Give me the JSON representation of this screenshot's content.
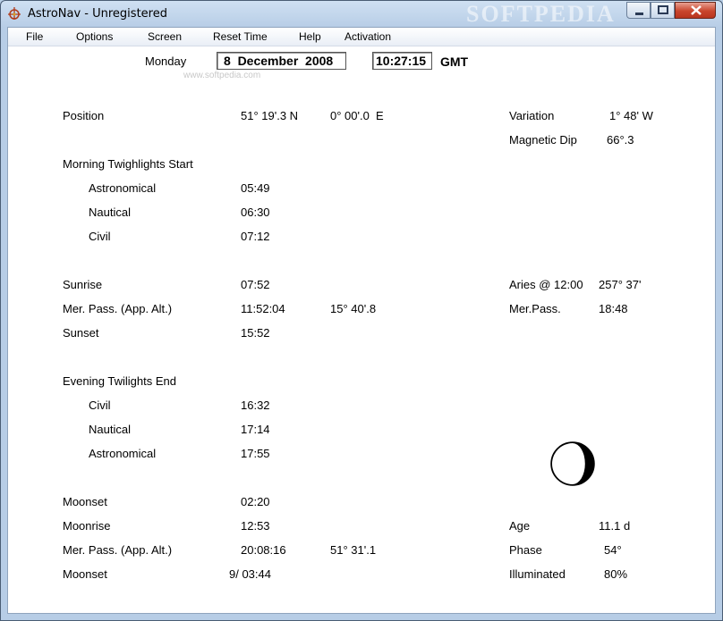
{
  "window": {
    "title": "AstroNav - Unregistered",
    "watermark": "SOFTPEDIA"
  },
  "menu": [
    "File",
    "Options",
    "Screen",
    "Reset Time",
    "Help",
    "Activation"
  ],
  "header": {
    "day": "Monday",
    "date": "8  December  2008",
    "time": "10:27:15",
    "timezone": "GMT",
    "watermark_small": "www.softpedia.com"
  },
  "position": {
    "label": "Position",
    "lat": "51° 19'.3 N",
    "lon": "0° 00'.0  E"
  },
  "variation": {
    "label": "Variation",
    "value": "1° 48' W"
  },
  "magnetic_dip": {
    "label": "Magnetic Dip",
    "value": "66°.3"
  },
  "morning": {
    "label": "Morning Twighlights Start",
    "rows": [
      {
        "label": "Astronomical",
        "value": "05:49"
      },
      {
        "label": "Nautical",
        "value": "06:30"
      },
      {
        "label": "Civil",
        "value": "07:12"
      }
    ]
  },
  "sun": {
    "sunrise": {
      "label": "Sunrise",
      "value": "07:52"
    },
    "merpass": {
      "label": "Mer. Pass. (App. Alt.)",
      "value": "11:52:04",
      "alt": "15° 40'.8"
    },
    "sunset": {
      "label": "Sunset",
      "value": "15:52"
    }
  },
  "aries": {
    "label": "Aries @ 12:00",
    "value": "257° 37'"
  },
  "aries_merpass": {
    "label": "Mer.Pass.",
    "value": "18:48"
  },
  "evening": {
    "label": "Evening Twilights End",
    "rows": [
      {
        "label": "Civil",
        "value": "16:32"
      },
      {
        "label": "Nautical",
        "value": "17:14"
      },
      {
        "label": "Astronomical",
        "value": "17:55"
      }
    ]
  },
  "moon": {
    "moonset": {
      "label": "Moonset",
      "value": "02:20"
    },
    "moonrise": {
      "label": "Moonrise",
      "value": "12:53"
    },
    "merpass": {
      "label": "Mer. Pass. (App. Alt.)",
      "value": "20:08:16",
      "alt": "51° 31'.1"
    },
    "moonset2": {
      "label": "Moonset",
      "value": "9/ 03:44"
    },
    "age": {
      "label": "Age",
      "value": "11.1 d"
    },
    "phase": {
      "label": "Phase",
      "value": "54°"
    },
    "illuminated": {
      "label": "Illuminated",
      "value": "80%"
    },
    "illuminated_fraction": 0.8
  }
}
